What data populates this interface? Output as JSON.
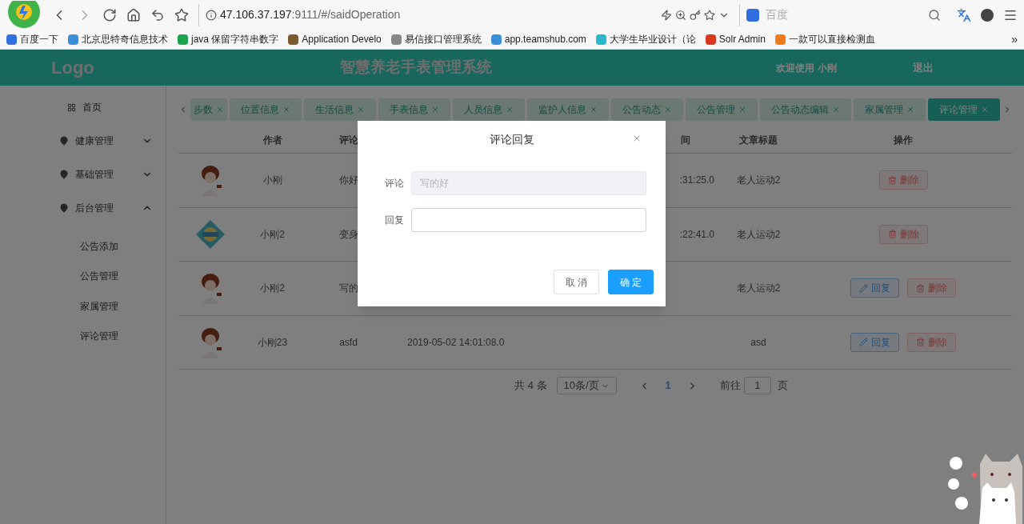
{
  "browser": {
    "url_host": "47.106.37.197",
    "url_path": ":9111/#/saidOperation",
    "search_placeholder": "百度",
    "bookmarks": [
      {
        "label": "百度一下",
        "color": "#2f6fe0"
      },
      {
        "label": "北京思特奇信息技术",
        "color": "#3b8fd8"
      },
      {
        "label": "java 保留字符串数字",
        "color": "#1aa34a"
      },
      {
        "label": "Application Develo",
        "color": "#7a5a2e"
      },
      {
        "label": "易信接口管理系统",
        "color": "#888888"
      },
      {
        "label": "app.teamshub.com",
        "color": "#3b8fd8"
      },
      {
        "label": "大学生毕业设计（论",
        "color": "#2ab7c9"
      },
      {
        "label": "Solr Admin",
        "color": "#d9381e"
      },
      {
        "label": "一款可以直接检测血",
        "color": "#f07a1a"
      }
    ],
    "more_bookmarks": "»"
  },
  "header": {
    "logo": "Logo",
    "title": "智慧养老手表管理系统",
    "welcome": "欢迎使用",
    "user": "小刚",
    "logout": "退出"
  },
  "sidebar": {
    "items": [
      {
        "kind": "link",
        "label": "首页"
      },
      {
        "kind": "group",
        "label": "健康管理",
        "expanded": false
      },
      {
        "kind": "group",
        "label": "基础管理",
        "expanded": false
      },
      {
        "kind": "group",
        "label": "后台管理",
        "expanded": true,
        "children": [
          {
            "label": "公告添加"
          },
          {
            "label": "公告管理"
          },
          {
            "label": "家属管理"
          },
          {
            "label": "评论管理"
          }
        ]
      }
    ]
  },
  "tabs": [
    {
      "label": "步数",
      "selected": false
    },
    {
      "label": "位置信息",
      "selected": false
    },
    {
      "label": "生活信息",
      "selected": false
    },
    {
      "label": "手表信息",
      "selected": false
    },
    {
      "label": "人员信息",
      "selected": false
    },
    {
      "label": "监护人信息",
      "selected": false
    },
    {
      "label": "公告动态",
      "selected": false
    },
    {
      "label": "公告管理",
      "selected": false
    },
    {
      "label": "公告动态编辑",
      "selected": false
    },
    {
      "label": "家属管理",
      "selected": false
    },
    {
      "label": "评论管理",
      "selected": true
    }
  ],
  "table": {
    "columns": {
      "author": "作者",
      "comment": "评论",
      "time2": "间",
      "title": "文章标题",
      "actions": "操作"
    },
    "rows": [
      {
        "author": "小刚",
        "comment": "你好",
        "time2": ":31:25.0",
        "title": "老人运动2",
        "actions": [
          {
            "kind": "delete",
            "label": "删除"
          }
        ]
      },
      {
        "author": "小刚2",
        "comment": "变身",
        "time2": ":22:41.0",
        "title": "老人运动2",
        "actions": [
          {
            "kind": "delete",
            "label": "删除"
          }
        ]
      },
      {
        "author": "小刚2",
        "comment": "写的",
        "title": "老人运动2",
        "actions": [
          {
            "kind": "reply",
            "label": "回复"
          },
          {
            "kind": "delete",
            "label": "删除"
          }
        ]
      },
      {
        "author": "小刚23",
        "comment": "asfd",
        "time": "2019-05-02 14:01:08.0",
        "title": "asd",
        "actions": [
          {
            "kind": "reply",
            "label": "回复"
          },
          {
            "kind": "delete",
            "label": "删除"
          }
        ]
      }
    ]
  },
  "pagination": {
    "total": "共 4 条",
    "page_size": "10条/页",
    "pages": [
      {
        "label": "1",
        "selected": true
      }
    ],
    "goto_label": "前往",
    "goto_value": "1",
    "page_unit": "页"
  },
  "dialog": {
    "title": "评论回复",
    "fields": [
      {
        "label": "评论",
        "value": "写的好",
        "disabled": true
      },
      {
        "label": "回复",
        "disabled": false
      }
    ],
    "buttons": [
      {
        "kind": "default",
        "label": "取 消"
      },
      {
        "kind": "primary",
        "label": "确 定"
      }
    ]
  }
}
